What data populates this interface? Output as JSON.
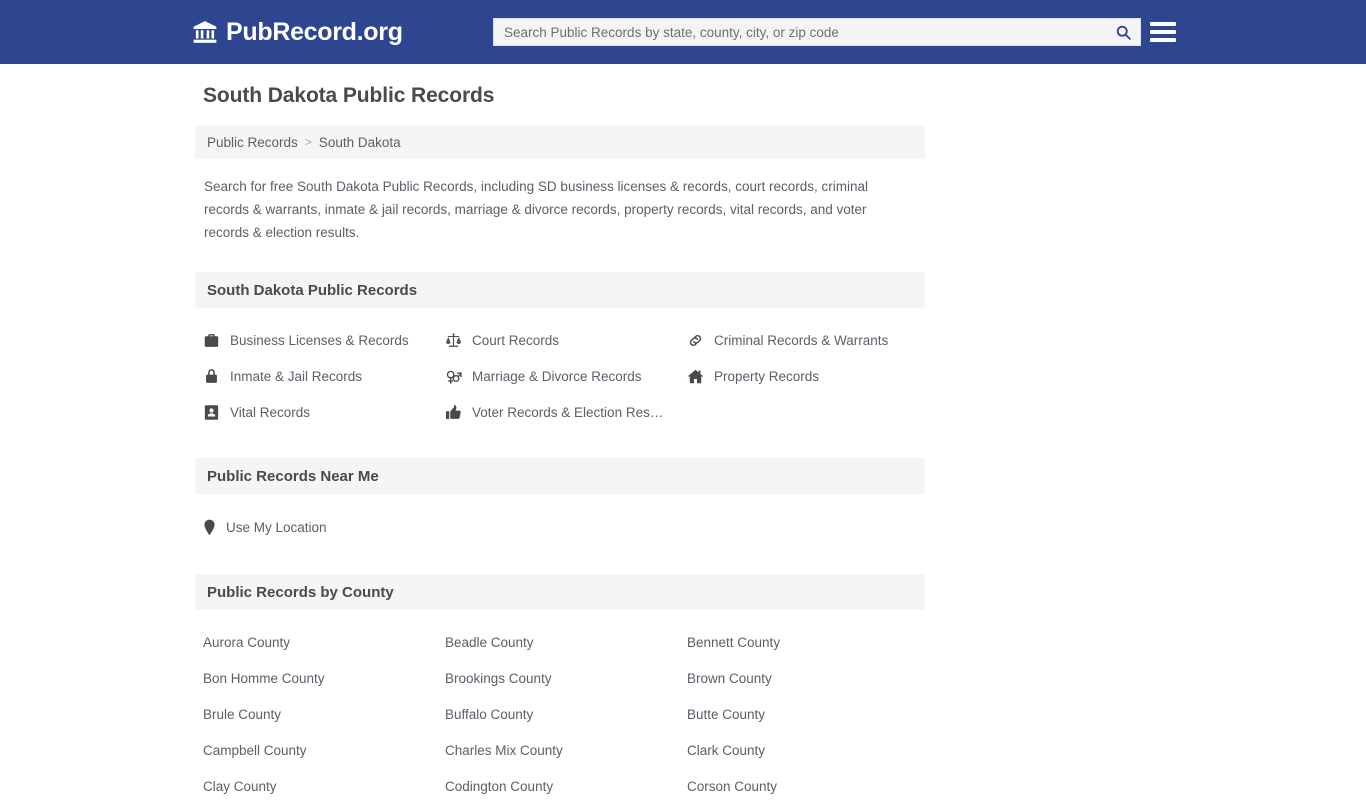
{
  "header": {
    "brand_name": "PubRecord.org",
    "brand_icon": "bank-icon",
    "search": {
      "placeholder": "Search Public Records by state, county, city, or zip code",
      "value": "",
      "icon": "search-icon"
    },
    "menu_icon": "hamburger-menu-icon",
    "background_color": "#2e4590"
  },
  "page": {
    "title": "South Dakota Public Records",
    "breadcrumb": {
      "root": "Public Records",
      "separator": ">",
      "current": "South Dakota"
    },
    "intro": "Search for free South Dakota Public Records, including SD business licenses & records, court records, criminal records & warrants, inmate & jail records, marriage & divorce records, property records, vital records, and voter records & election results."
  },
  "records_section": {
    "heading": "South Dakota Public Records",
    "links": [
      {
        "label": "Business Licenses & Records",
        "icon": "briefcase-icon"
      },
      {
        "label": "Court Records",
        "icon": "balance-scale-icon"
      },
      {
        "label": "Criminal Records & Warrants",
        "icon": "handcuffs-link-icon"
      },
      {
        "label": "Inmate & Jail Records",
        "icon": "lock-icon"
      },
      {
        "label": "Marriage & Divorce Records",
        "icon": "venus-mars-icon"
      },
      {
        "label": "Property Records",
        "icon": "home-icon"
      },
      {
        "label": "Vital Records",
        "icon": "id-card-icon"
      },
      {
        "label": "Voter Records & Election Res…",
        "icon": "thumbs-up-icon"
      }
    ]
  },
  "near_me_section": {
    "heading": "Public Records Near Me",
    "links": [
      {
        "label": "Use My Location",
        "icon": "map-marker-icon"
      }
    ]
  },
  "county_section": {
    "heading": "Public Records by County",
    "counties": [
      "Aurora County",
      "Beadle County",
      "Bennett County",
      "Bon Homme County",
      "Brookings County",
      "Brown County",
      "Brule County",
      "Buffalo County",
      "Butte County",
      "Campbell County",
      "Charles Mix County",
      "Clark County",
      "Clay County",
      "Codington County",
      "Corson County"
    ]
  }
}
